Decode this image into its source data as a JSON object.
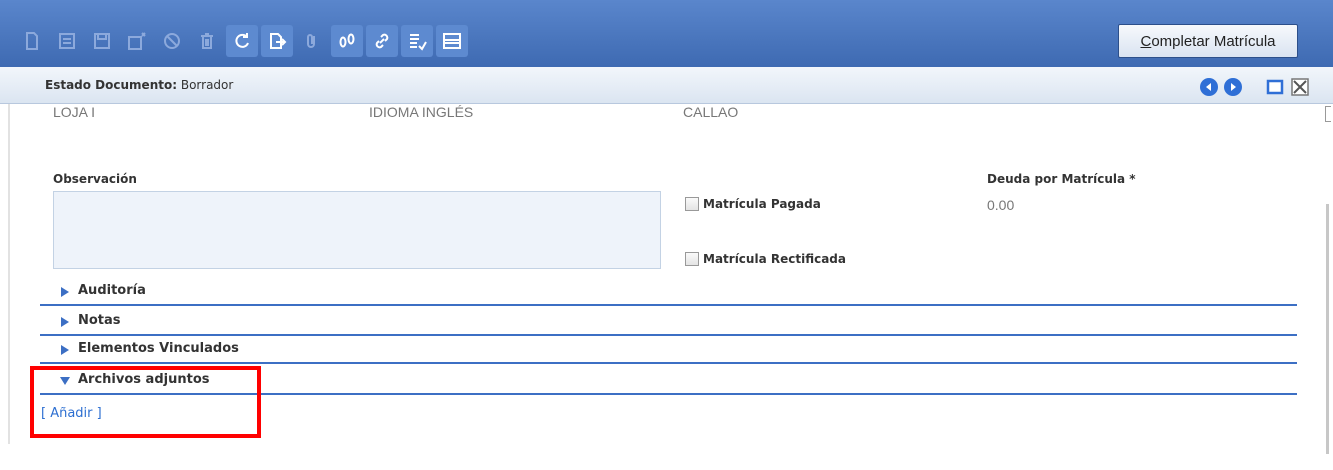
{
  "toolbar": {
    "buttons": [
      {
        "icon": "new-document-icon",
        "enabled": false
      },
      {
        "icon": "copy-record-icon",
        "enabled": false
      },
      {
        "icon": "save-icon",
        "enabled": false
      },
      {
        "icon": "save-close-icon",
        "enabled": false
      },
      {
        "icon": "cancel-icon",
        "enabled": false
      },
      {
        "icon": "delete-icon",
        "enabled": false
      },
      {
        "icon": "refresh-icon",
        "enabled": true
      },
      {
        "icon": "export-icon",
        "enabled": true
      },
      {
        "icon": "attachment-icon",
        "enabled": false
      },
      {
        "icon": "footprints-icon",
        "enabled": true
      },
      {
        "icon": "link-icon",
        "enabled": true
      },
      {
        "icon": "checklist-icon",
        "enabled": true
      },
      {
        "icon": "layout-icon",
        "enabled": true
      }
    ],
    "complete_button": {
      "accel": "C",
      "rest": "ompletar Matrícula"
    }
  },
  "status": {
    "label": "Estado Documento:",
    "value": "Borrador"
  },
  "record": {
    "field1": "LOJA I",
    "field2": "IDIOMA INGLÉS",
    "field3": "CALLAO"
  },
  "form": {
    "observation_label": "Observación",
    "observation_value": "",
    "paid_label": "Matrícula Pagada",
    "paid_checked": false,
    "rectified_label": "Matrícula Rectificada",
    "rectified_checked": false,
    "debt_label": "Deuda por Matrícula *",
    "debt_value": "0.00"
  },
  "sections": [
    {
      "label": "Auditoría",
      "expanded": false
    },
    {
      "label": "Notas",
      "expanded": false
    },
    {
      "label": "Elementos Vinculados",
      "expanded": false
    },
    {
      "label": "Archivos adjuntos",
      "expanded": true
    }
  ],
  "attachments": {
    "add_label": "[ Añadir ]"
  },
  "colors": {
    "toolbar": "#4a76be",
    "accent": "#3c6fc4",
    "link": "#2d6fd1",
    "highlight": "#ff0000"
  }
}
